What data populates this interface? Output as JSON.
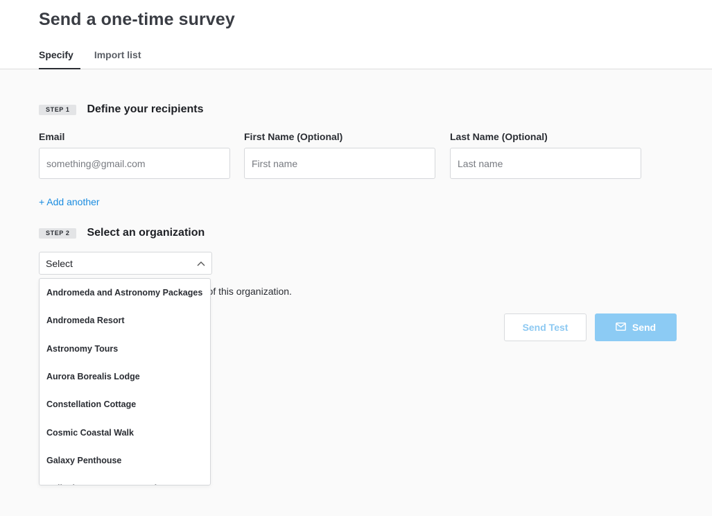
{
  "header": {
    "title": "Send a one-time survey",
    "tabs": [
      {
        "label": "Specify",
        "active": true
      },
      {
        "label": "Import list",
        "active": false
      }
    ]
  },
  "step1": {
    "badge": "STEP 1",
    "title": "Define your recipients",
    "fields": {
      "email": {
        "label": "Email",
        "placeholder": "something@gmail.com",
        "value": ""
      },
      "first_name": {
        "label": "First Name (Optional)",
        "placeholder": "First name",
        "value": ""
      },
      "last_name": {
        "label": "Last Name (Optional)",
        "placeholder": "Last name",
        "value": ""
      }
    },
    "add_another": "+ Add another"
  },
  "step2": {
    "badge": "STEP 2",
    "title": "Select an organization",
    "select_value": "Select",
    "help_text": "The survey will use the survey settings of this organization.",
    "options": [
      "Andromeda and Astronomy Packages",
      "Andromeda Resort",
      "Astronomy Tours",
      "Aurora Borealis Lodge",
      "Constellation Cottage",
      "Cosmic Coastal Walk",
      "Galaxy Penthouse",
      "Heliosis Space Homestead"
    ]
  },
  "actions": {
    "send_test": "Send Test",
    "send": "Send"
  },
  "colors": {
    "accent_link": "#1a8ce0",
    "send_button": "#8ccbf4",
    "send_test_text": "#8dc9f2"
  },
  "icons": {
    "select_chevron": "chevron-up-icon",
    "send": "envelope-icon"
  }
}
